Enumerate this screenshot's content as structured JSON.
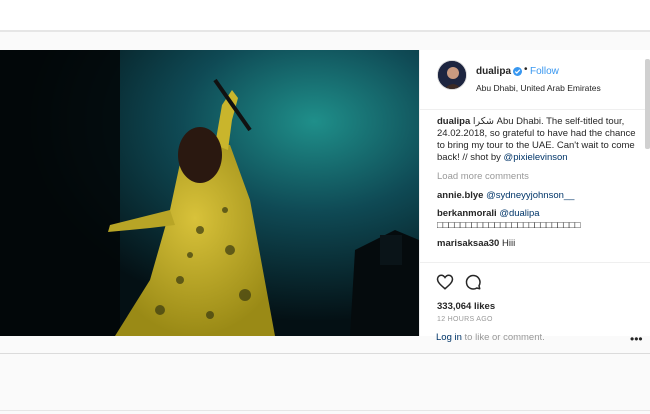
{
  "header": {
    "username": "dualipa",
    "follow_label": "Follow",
    "separator": "•",
    "location": "Abu Dhabi, United Arab Emirates"
  },
  "caption": {
    "username": "dualipa",
    "text": " شكرا Abu Dhabi. The self-titled tour, 24.02.2018, so grateful to have had the chance to bring my tour to the UAE. Can't wait to come back! // shot by ",
    "mention": "@pixielevinson"
  },
  "load_more": "Load more comments",
  "comments": [
    {
      "user": "annie.blye",
      "mention": "@sydneyyjohnson__",
      "text": ""
    },
    {
      "user": "berkanmorali",
      "mention": "@dualipa",
      "text": " □□□□□□□□□□□□□□□□□□□□□□□□□"
    },
    {
      "user": "marisaksaa30",
      "mention": "",
      "text": " Hiii"
    }
  ],
  "likes": "333,064 likes",
  "timestamp": "12 HOURS AGO",
  "login": {
    "link": "Log in",
    "rest": " to like or comment."
  },
  "more_options": "•••",
  "photo_watermark": "",
  "icons": {
    "like": "heart-icon",
    "comment": "comment-icon",
    "verified": "verified-badge-icon",
    "more": "more-options-icon"
  },
  "colors": {
    "accent": "#3897f0",
    "link": "#003569",
    "muted": "#999999"
  }
}
